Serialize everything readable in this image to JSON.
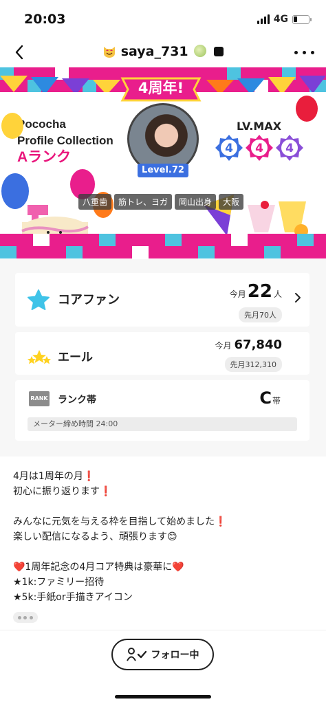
{
  "status_bar": {
    "time": "20:03",
    "network": "4G"
  },
  "nav": {
    "title": "saya_731"
  },
  "banner": {
    "anniversary": "4周年!",
    "brand_line1": "Pococha",
    "brand_line2": "Profile Collection",
    "rank": "Aランク",
    "level": "Level.72",
    "lv_max": "LV.MAX",
    "tags": [
      "八重歯",
      "筋トレ、ヨガ",
      "岡山出身",
      "大阪"
    ],
    "medal_digit": "4"
  },
  "core_fan": {
    "label": "コアファン",
    "this_month_prefix": "今月",
    "this_month_value": "22",
    "unit": "人",
    "last_month": "先月70人"
  },
  "yell": {
    "label": "エール",
    "this_month_prefix": "今月",
    "this_month_value": "67,840",
    "last_month": "先月312,310"
  },
  "rank_band": {
    "icon_text": "RANK",
    "label": "ランク帯",
    "value": "C",
    "suffix": "帯",
    "meter_text": "メーター締め時間 24:00"
  },
  "bio": {
    "lines": [
      "4月は1周年の月❗️",
      "初心に振り返ります❗️",
      "",
      "みんなに元気を与える枠を目指して始めました❗️",
      "楽しい配信になるよう、頑張ります😊",
      "",
      "❤️1周年記念の4月コア特典は豪華に❤️",
      "★1k:ファミリー招待",
      "★5k:手紙or手描きアイコン"
    ]
  },
  "footer": {
    "follow_label": "フォロー中"
  }
}
